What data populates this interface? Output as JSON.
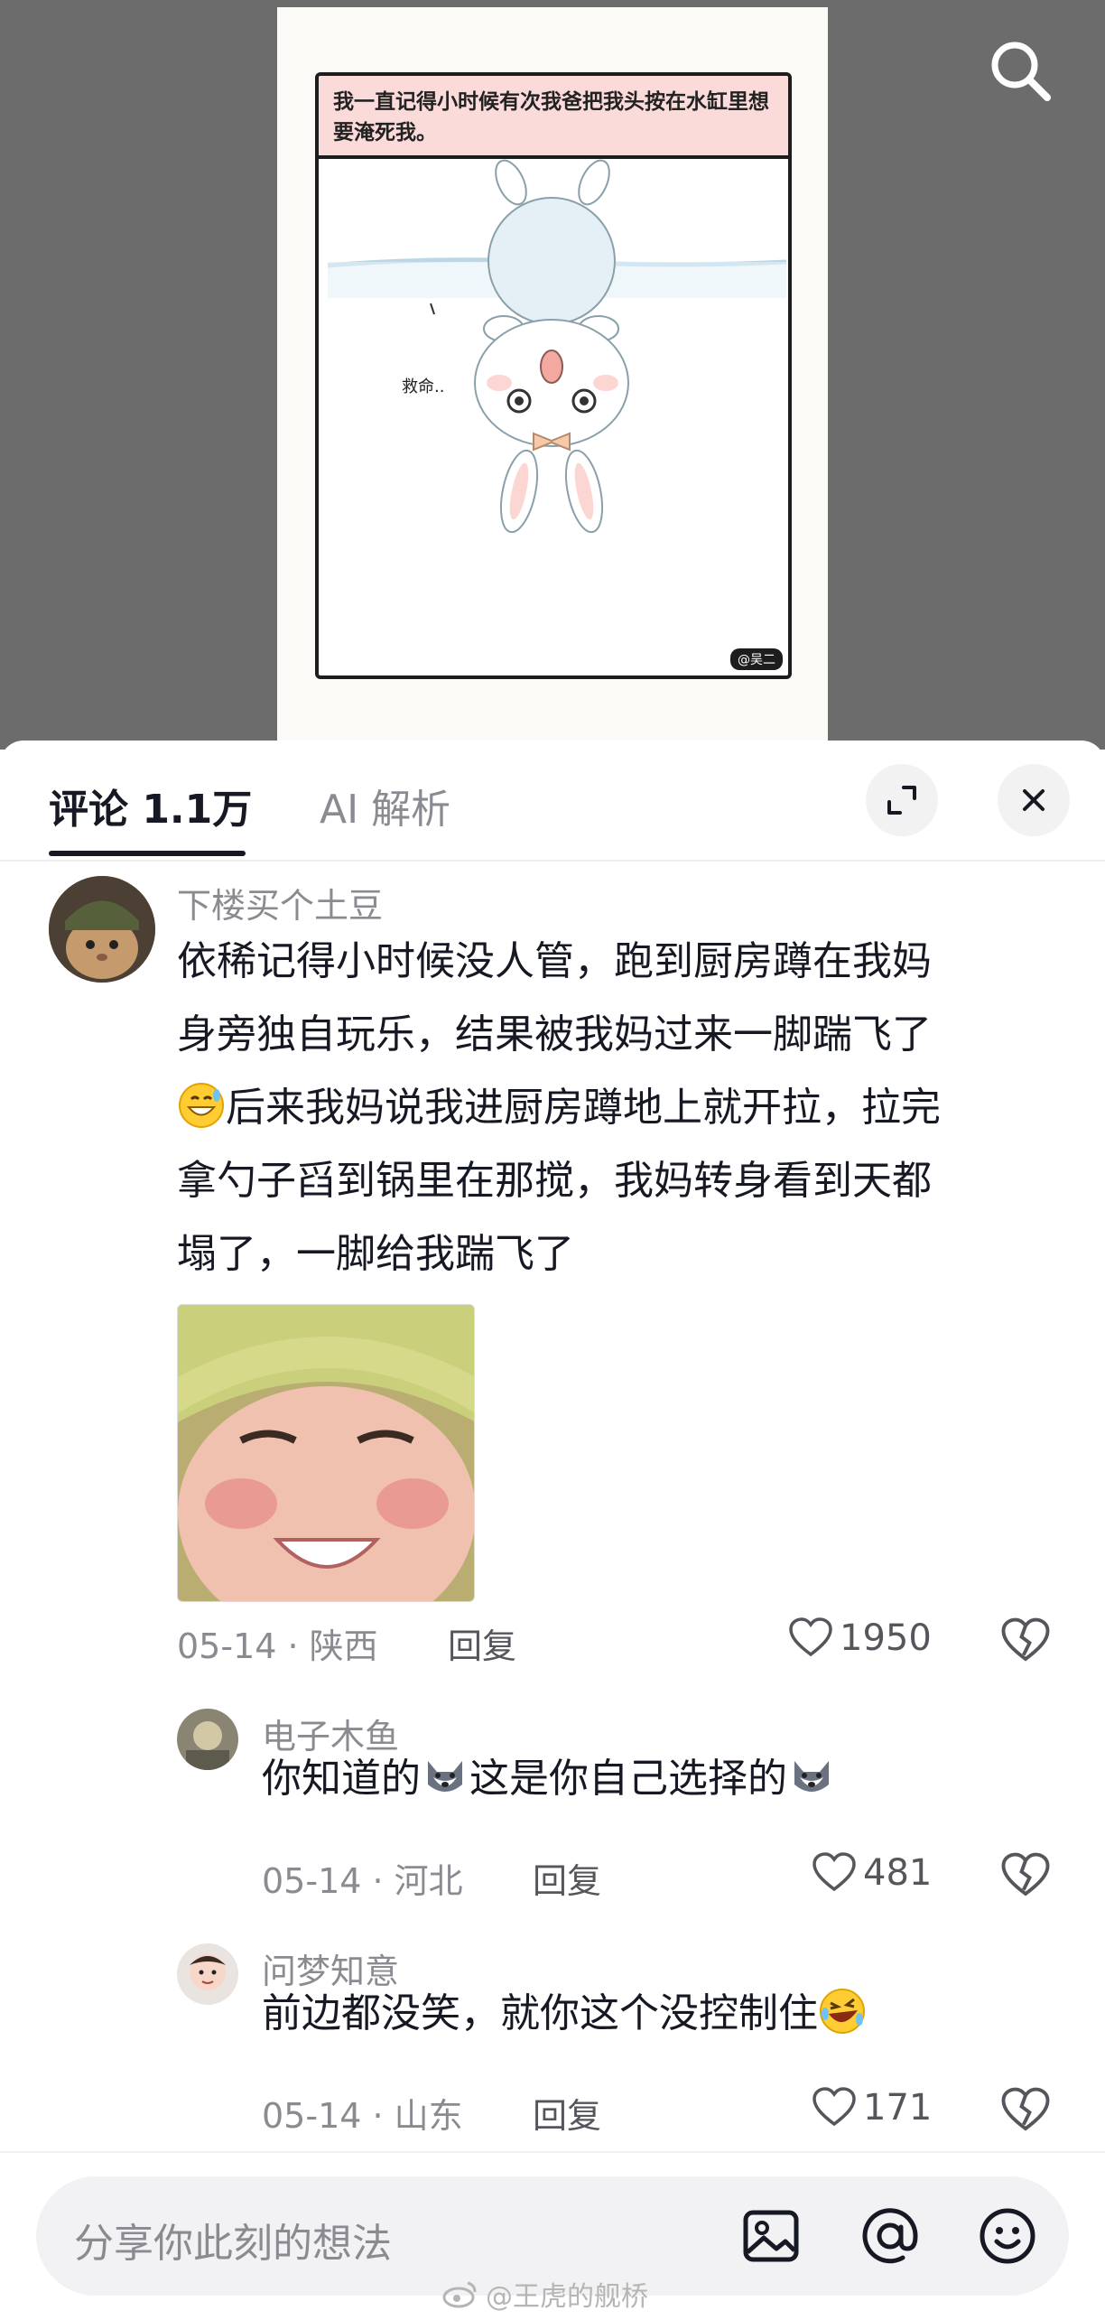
{
  "media": {
    "comic_caption": "我一直记得小时候有次我爸把我头按在水缸里想要淹死我。",
    "comic_bubble": "救命..",
    "comic_signature": "@吴二"
  },
  "sheet": {
    "tab_comments": "评论 1.1万",
    "tab_ai": "AI 解析"
  },
  "comments": [
    {
      "author": "下楼买个土豆",
      "lines": [
        "依稀记得小时候没人管，跑到厨房蹲在我妈",
        "身旁独自玩乐，结果被我妈过来一脚踹飞了",
        "后来我妈说我进厨房蹲地上就开拉，拉完",
        "拿勺子舀到锅里在那搅，我妈转身看到天都",
        "塌了，一脚给我踹飞了"
      ],
      "meta": "05-14 · 陕西",
      "reply": "回复",
      "likes": "1950"
    },
    {
      "author": "电子木鱼",
      "text_a": "你知道的",
      "text_b": "这是你自己选择的",
      "meta": "05-14 · 河北",
      "reply": "回复",
      "likes": "481"
    },
    {
      "author": "问梦知意",
      "text": "前边都没笑，就你这个没控制住",
      "meta": "05-14 · 山东",
      "reply": "回复",
      "likes": "171"
    }
  ],
  "input": {
    "placeholder": "分享你此刻的想法"
  },
  "watermark": "@王虎的舰桥",
  "colors": {
    "accent_text": "#161823",
    "secondary_text": "#8a8b91",
    "caption_bg": "#fbdada",
    "media_bg": "#6c6c6c"
  }
}
